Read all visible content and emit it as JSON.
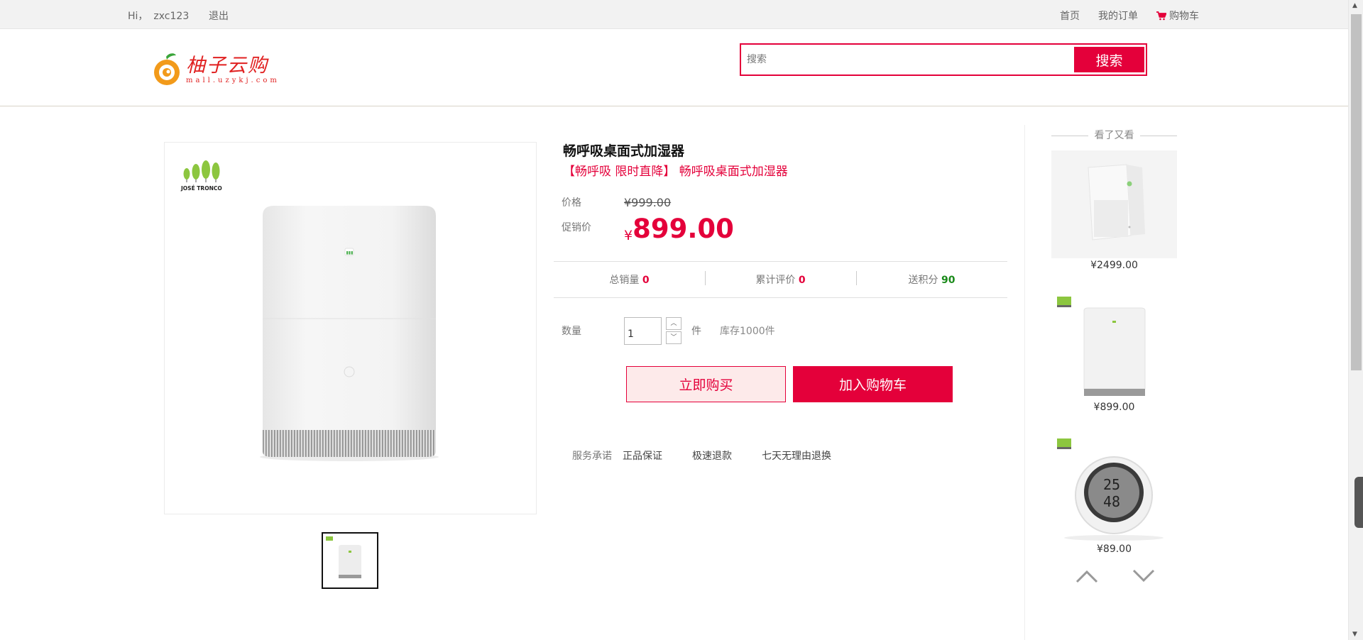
{
  "topbar": {
    "greeting": "Hi，",
    "username": "zxc123",
    "logout": "退出",
    "home": "首页",
    "orders": "我的订单",
    "cart": "购物车"
  },
  "header": {
    "logo_name": "柚子云购",
    "logo_url": "mall.uzykj.com",
    "search_placeholder": "搜索",
    "search_button": "搜索"
  },
  "product": {
    "brand": "JOSÉ TRONCO",
    "title": "畅呼吸桌面式加湿器",
    "subtitle": "【畅呼吸 限时直降】 畅呼吸桌面式加湿器",
    "price_label": "价格",
    "price": "¥999.00",
    "promo_label": "促销价",
    "currency": "¥",
    "promo_price": "899.00",
    "stats": {
      "sales_label": "总销量",
      "sales": "0",
      "reviews_label": "累计评价",
      "reviews": "0",
      "points_label": "送积分",
      "points": "90"
    },
    "quantity_label": "数量",
    "quantity": "1",
    "unit": "件",
    "stock": "库存1000件",
    "buy_now": "立即购买",
    "add_to_cart": "加入购物车",
    "service_label": "服务承诺",
    "services": [
      "正品保证",
      "极速退款",
      "七天无理由退换"
    ]
  },
  "recommendations": {
    "title": "看了又看",
    "items": [
      {
        "price": "¥2499.00"
      },
      {
        "price": "¥899.00"
      },
      {
        "price": "¥89.00",
        "display_top": "25",
        "display_bottom": "48"
      }
    ]
  },
  "colors": {
    "accent": "#e4003a",
    "points_green": "#1a8a1a"
  }
}
